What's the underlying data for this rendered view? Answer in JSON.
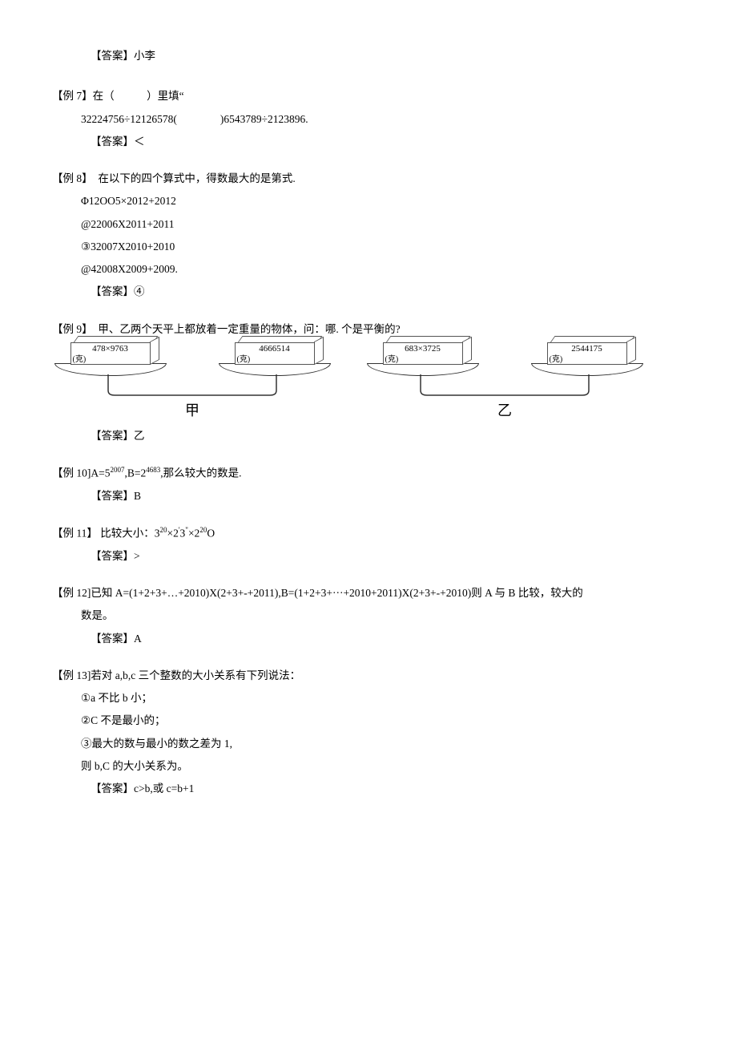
{
  "pre_answer": {
    "label": "【答案】",
    "value": "小李"
  },
  "ex7": {
    "title": "【例 7】在（　　　）里填“",
    "line": "32224756÷12126578(　　　　)6543789÷2123896.",
    "answer_label": "【答案】",
    "answer_value": "＜"
  },
  "ex8": {
    "title": "【例 8】　在以下的四个算式中，得数最大的是第式.",
    "opts": [
      "Φ12OO5×2012+2012",
      "@22006X2011+2011",
      "③32007X2010+2010",
      "@42008X2009+2009."
    ],
    "answer_label": "【答案】",
    "answer_value": "④"
  },
  "ex9": {
    "title": "【例 9】　甲、乙两个天平上都放着一定重量的物体，问：哪. 个是平衡的?",
    "balances": [
      {
        "left": "478×9763",
        "right": "4666514",
        "label": "甲"
      },
      {
        "left": "683×3725",
        "right": "2544175",
        "label": "乙"
      }
    ],
    "unit": "(克)",
    "answer_label": "【答案】",
    "answer_value": "乙"
  },
  "ex10": {
    "title_pre": "【例 10]A=5",
    "sup1": "2007",
    "mid": ",B=2",
    "sup2": "4683",
    "tail": ",那么较大的数是.",
    "answer_label": "【答案】",
    "answer_value": "B"
  },
  "ex11": {
    "title_pre": "【例 11】 比较大小：3",
    "s1": "20",
    "m1": "×2",
    "s2": "'",
    "m2": "3",
    "s3": "\"",
    "m3": "×2",
    "s4": "20",
    "tail": "O",
    "answer_label": "【答案】",
    "answer_value": ">"
  },
  "ex12": {
    "title": "【例 12]已知 A=(1+2+3+…+2010)X(2+3+-+2011),B=(1+2+3+···+2010+2011)X(2+3+-+2010)则 A 与 B 比较，较大的",
    "line2": "数是。",
    "answer_label": "【答案】",
    "answer_value": "A"
  },
  "ex13": {
    "title": "【例 13]若对 a,b,c 三个整数的大小关系有下列说法：",
    "opts": [
      "①a 不比 b 小；",
      "②C 不是最小的；",
      "③最大的数与最小的数之差为 1,",
      "则 b,C 的大小关系为。"
    ],
    "answer_label": "【答案】",
    "answer_value": "c>b,或 c=b+1"
  }
}
